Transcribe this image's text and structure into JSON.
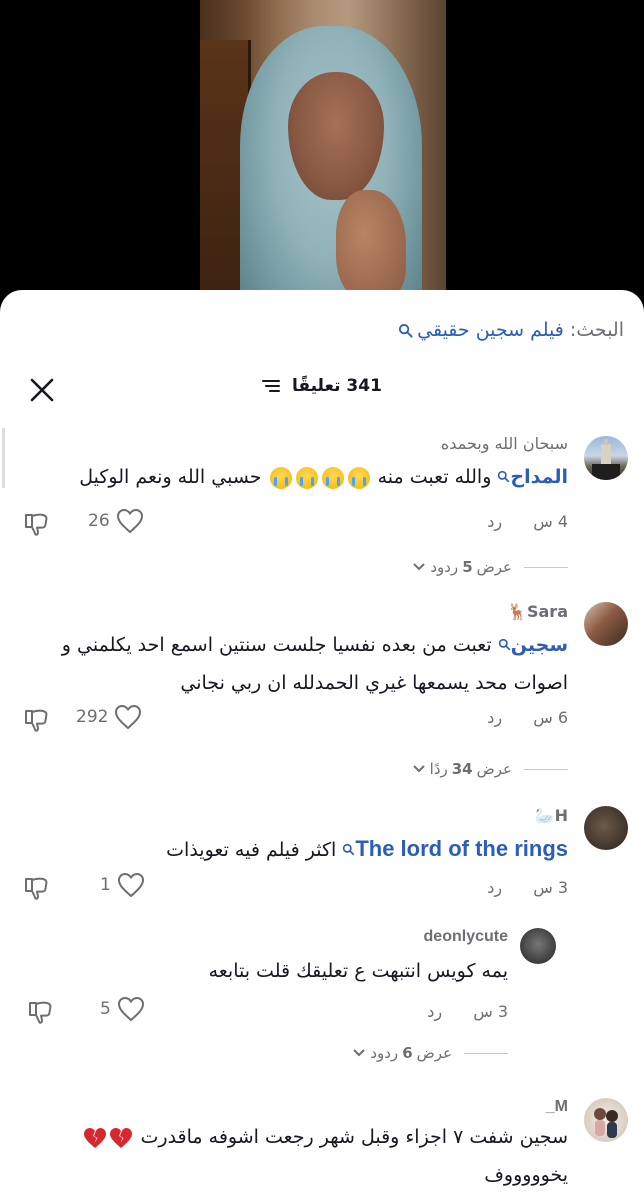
{
  "search": {
    "label": "البحث:",
    "term": "فيلم سجين حقيقي"
  },
  "header": {
    "count": "341 تعليقًا"
  },
  "comments": [
    {
      "username": "سبحان الله وبحمده",
      "mention": "المداح",
      "text": "والله تعبت منه",
      "text_after": "حسبي الله ونعم الوكيل",
      "emojis": [
        "loudly-crying-face",
        "loudly-crying-face",
        "loudly-crying-face",
        "loudly-crying-face"
      ],
      "time": "4 س",
      "reply": "رد",
      "likes": "26",
      "view_replies_prefix": "عرض",
      "view_replies_count": "5",
      "view_replies_suffix": "ردود"
    },
    {
      "username": "Sara🦌",
      "mention": "سجين",
      "line1": "تعبت من بعده نفسيا جلست سنتين اسمع احد يكلمني و",
      "line2": "اصوات محد يسمعها غيري الحمدلله ان ربي نجاني",
      "time": "6 س",
      "reply": "رد",
      "likes": "292",
      "view_replies_prefix": "عرض",
      "view_replies_count": "34",
      "view_replies_suffix": "ردًا"
    },
    {
      "username": "H🦢",
      "mention": "The lord of the rings",
      "text": "اكثر فيلم فيه تعويذات",
      "time": "3 س",
      "reply": "رد",
      "likes": "1"
    },
    {
      "username": "deonlycute",
      "text": "يمه كويس انتبهت ع تعليقك قلت بتابعه",
      "time": "3 س",
      "reply": "رد",
      "likes": "5",
      "view_replies_prefix": "عرض",
      "view_replies_count": "6",
      "view_replies_suffix": "ردود"
    },
    {
      "username": "M_",
      "line1": "سجين شفت ٧ اجزاء وقبل شهر رجعت اشوفه ماقدرت",
      "line2": "يخوووووف",
      "emojis": [
        "broken-heart",
        "broken-heart"
      ]
    }
  ],
  "colors": {
    "link": "#2b5db9",
    "muted": "#6d6e75",
    "text": "#161823"
  }
}
